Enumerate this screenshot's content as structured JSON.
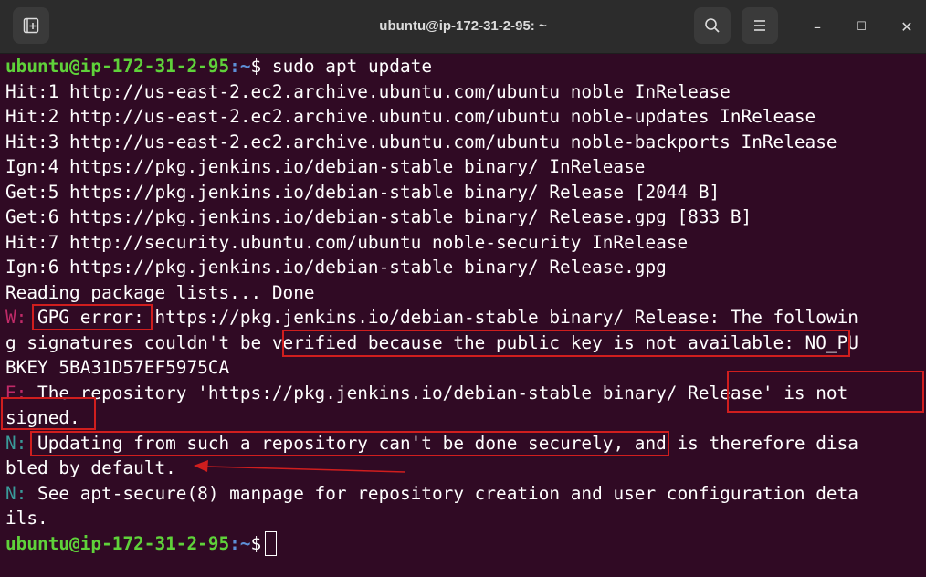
{
  "window": {
    "title": "ubuntu@ip-172-31-2-95: ~",
    "new_tab_icon": "new-tab-icon",
    "search_icon": "search-icon",
    "menu_icon": "hamburger-menu-icon",
    "minimize_label": "–",
    "maximize_label": "☐",
    "close_label": "✕"
  },
  "prompt": {
    "user_host": "ubuntu@ip-172-31-2-95",
    "path": ":~",
    "symbol": "$"
  },
  "command": " sudo apt update",
  "lines": [
    "Hit:1 http://us-east-2.ec2.archive.ubuntu.com/ubuntu noble InRelease",
    "Hit:2 http://us-east-2.ec2.archive.ubuntu.com/ubuntu noble-updates InRelease",
    "Hit:3 http://us-east-2.ec2.archive.ubuntu.com/ubuntu noble-backports InRelease",
    "Ign:4 https://pkg.jenkins.io/debian-stable binary/ InRelease",
    "Get:5 https://pkg.jenkins.io/debian-stable binary/ Release [2044 B]",
    "Get:6 https://pkg.jenkins.io/debian-stable binary/ Release.gpg [833 B]",
    "Hit:7 http://security.ubuntu.com/ubuntu noble-security InRelease",
    "Ign:6 https://pkg.jenkins.io/debian-stable binary/ Release.gpg",
    "Reading package lists... Done"
  ],
  "warning": {
    "prefix": "W:",
    "line1_rest": " GPG error: https://pkg.jenkins.io/debian-stable binary/ Release: The followin",
    "line2": "g signatures couldn't be verified because the public key is not available: NO_PU",
    "line3": "BKEY 5BA31D57EF5975CA"
  },
  "error": {
    "prefix": "E:",
    "line1_rest": " The repository 'https://pkg.jenkins.io/debian-stable binary/ Release' is not",
    "line2": "signed."
  },
  "notice1": {
    "prefix": "N:",
    "line1_rest": " Updating from such a repository can't be done securely, and is therefore disa",
    "line2": "bled by default."
  },
  "notice2": {
    "prefix": "N:",
    "line1_rest": " See apt-secure(8) manpage for repository creation and user configuration deta",
    "line2": "ils."
  },
  "colors": {
    "background": "#300a24",
    "prompt_user": "#5fd23a",
    "prompt_path": "#5d8fd6",
    "error_prefix": "#c02a68",
    "notice_prefix": "#3a9a9a",
    "annotation": "#d01e1e"
  }
}
